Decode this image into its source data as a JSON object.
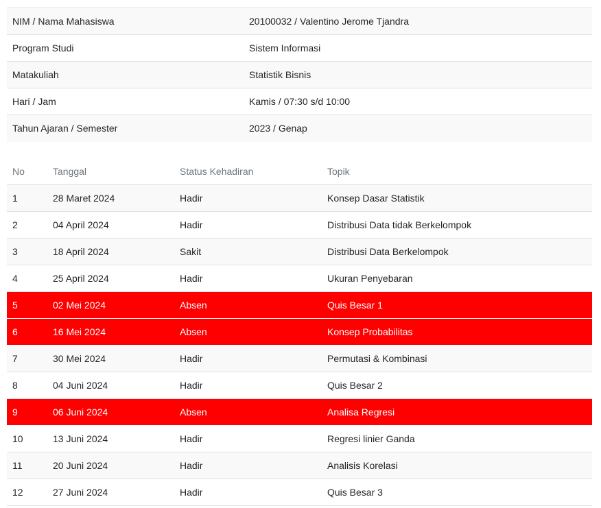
{
  "info": [
    {
      "label": "NIM / Nama Mahasiswa",
      "value": "20100032 / Valentino Jerome Tjandra"
    },
    {
      "label": "Program Studi",
      "value": "Sistem Informasi"
    },
    {
      "label": "Matakuliah",
      "value": "Statistik Bisnis"
    },
    {
      "label": "Hari / Jam",
      "value": "Kamis / 07:30 s/d 10:00"
    },
    {
      "label": "Tahun Ajaran / Semester",
      "value": "2023 / Genap"
    }
  ],
  "attendance": {
    "headers": {
      "no": "No",
      "date": "Tanggal",
      "status": "Status Kehadiran",
      "topic": "Topik"
    },
    "absent_color": "#ff0000",
    "rows": [
      {
        "no": "1",
        "date": "28 Maret 2024",
        "status": "Hadir",
        "topic": "Konsep Dasar Statistik"
      },
      {
        "no": "2",
        "date": "04 April 2024",
        "status": "Hadir",
        "topic": "Distribusi Data tidak Berkelompok"
      },
      {
        "no": "3",
        "date": "18 April 2024",
        "status": "Sakit",
        "topic": "Distribusi Data Berkelompok"
      },
      {
        "no": "4",
        "date": "25 April 2024",
        "status": "Hadir",
        "topic": "Ukuran Penyebaran"
      },
      {
        "no": "5",
        "date": "02 Mei 2024",
        "status": "Absen",
        "topic": "Quis Besar 1"
      },
      {
        "no": "6",
        "date": "16 Mei 2024",
        "status": "Absen",
        "topic": "Konsep Probabilitas"
      },
      {
        "no": "7",
        "date": "30 Mei 2024",
        "status": "Hadir",
        "topic": "Permutasi & Kombinasi"
      },
      {
        "no": "8",
        "date": "04 Juni 2024",
        "status": "Hadir",
        "topic": "Quis Besar 2"
      },
      {
        "no": "9",
        "date": "06 Juni 2024",
        "status": "Absen",
        "topic": "Analisa Regresi"
      },
      {
        "no": "10",
        "date": "13 Juni 2024",
        "status": "Hadir",
        "topic": "Regresi linier Ganda"
      },
      {
        "no": "11",
        "date": "20 Juni 2024",
        "status": "Hadir",
        "topic": "Analisis Korelasi"
      },
      {
        "no": "12",
        "date": "27 Juni 2024",
        "status": "Hadir",
        "topic": "Quis Besar 3"
      }
    ]
  }
}
